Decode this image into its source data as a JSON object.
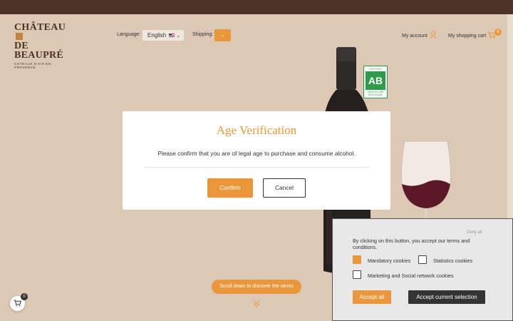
{
  "header": {
    "logo_line1": "CHÂTEAU",
    "logo_line2": "DE BEAUPRÉ",
    "logo_tagline": "COTEAUX D'AIX-EN-PROVENCE",
    "language_label": "Language:",
    "language_value": "English",
    "shipping_label": "Shipping:",
    "account_label": "My account",
    "cart_label": "My shopping cart",
    "cart_count": "0"
  },
  "badge": {
    "top": "CERTIFIÉ",
    "mark": "AB",
    "bottom1": "AGRICULTURE",
    "bottom2": "BIOLOGIQUE"
  },
  "modal": {
    "title": "Age Verification",
    "message": "Please confirm that you are of legal age to purchase and consume alcohol.",
    "confirm_label": "Confirm",
    "cancel_label": "Cancel"
  },
  "hero": {
    "scroll_label": "Scroll down to discover the wines"
  },
  "floating_cart": {
    "count": "0"
  },
  "cookies": {
    "deny_label": "Deny all",
    "text": "By clicking on this button, you accept our terms and conditions.",
    "options": [
      {
        "label": "Mandatory cookies",
        "checked": true
      },
      {
        "label": "Statistics cookies",
        "checked": false
      },
      {
        "label": "Marketing and Social network cookies",
        "checked": false
      }
    ],
    "accept_all_label": "Accept all",
    "accept_selection_label": "Accept current selection"
  },
  "colors": {
    "accent": "#e9973a",
    "topbar": "#4b3328",
    "background": "#dcc8b4"
  }
}
